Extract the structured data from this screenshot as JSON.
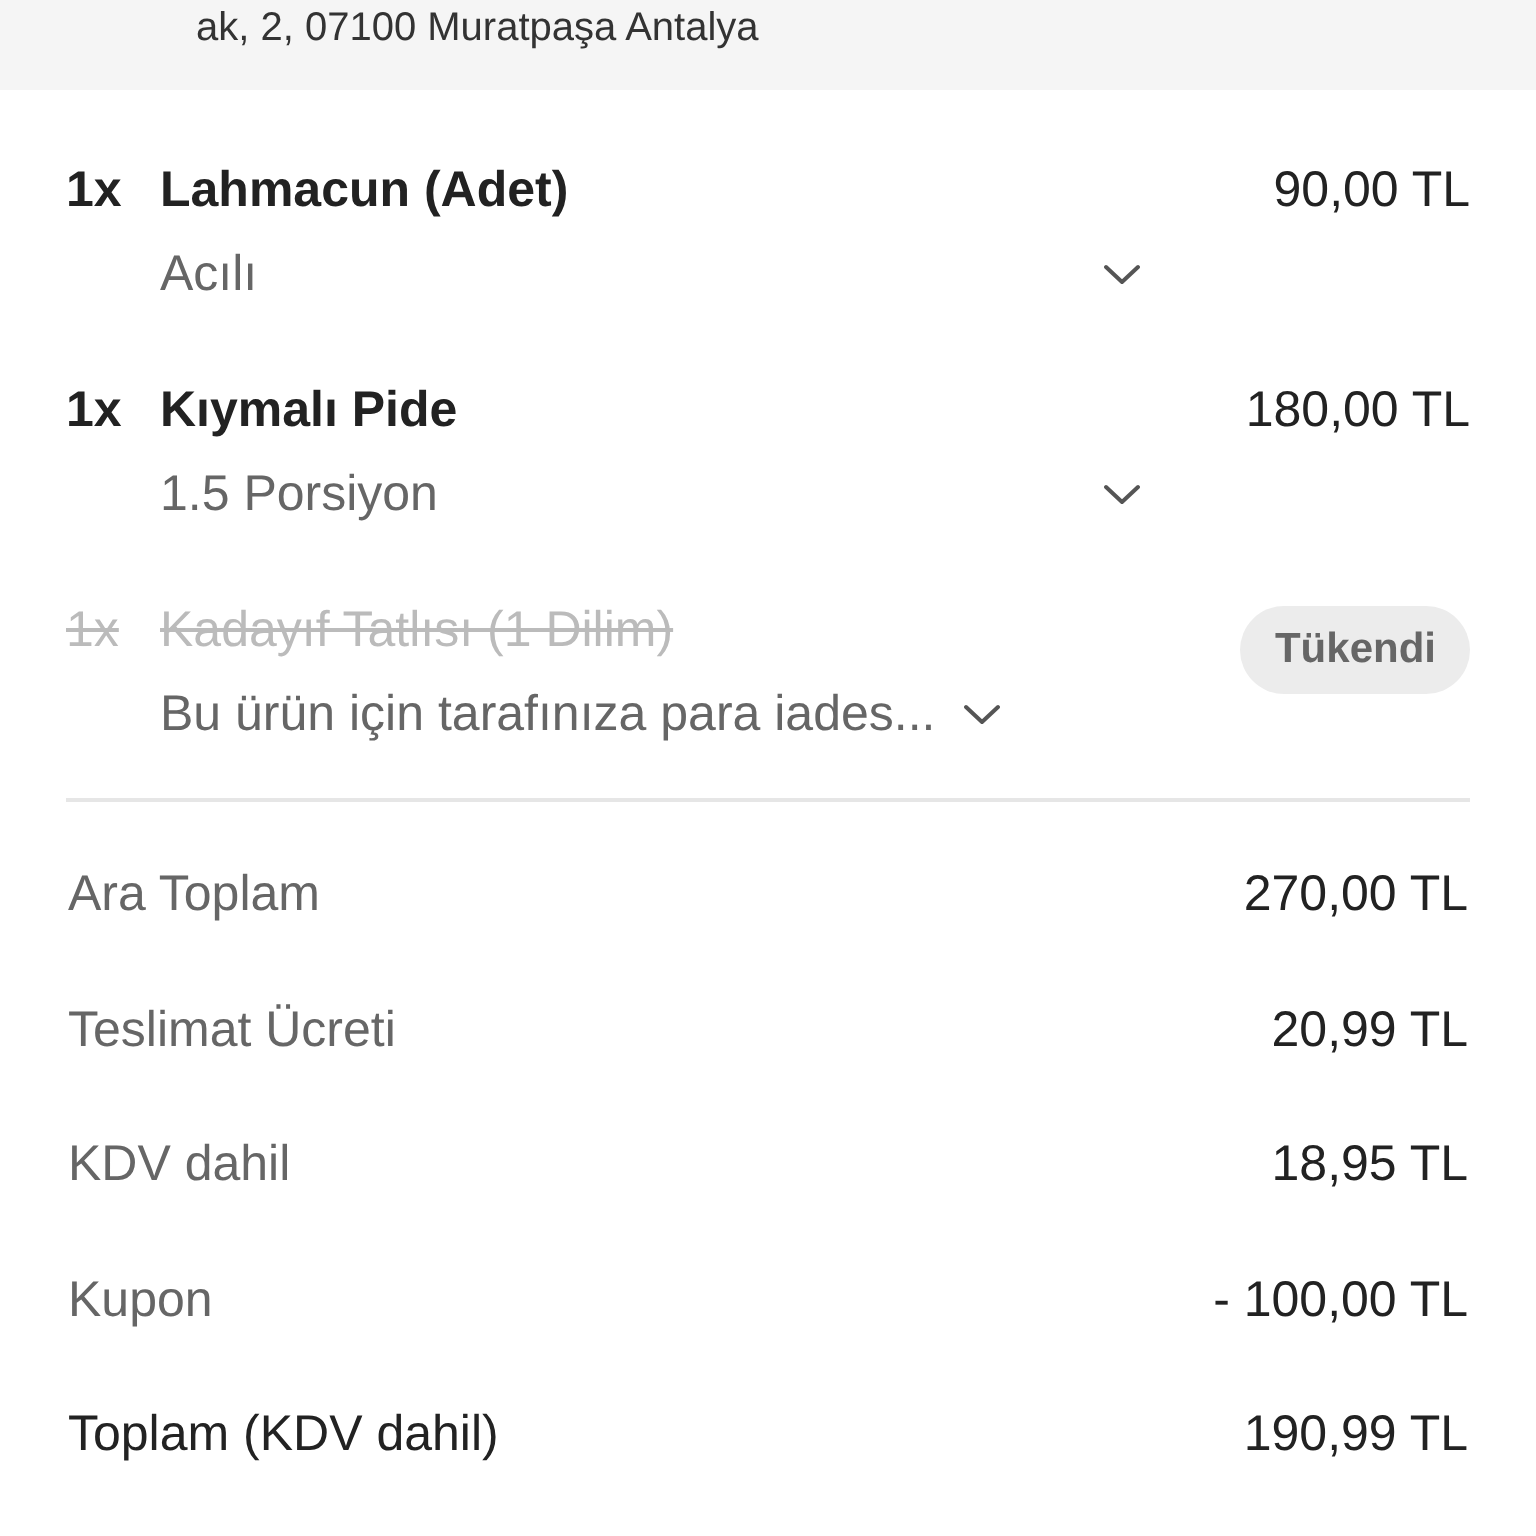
{
  "address": "ak, 2, 07100 Muratpaşa Antalya",
  "items": [
    {
      "quantity": "1x",
      "name": "Lahmacun (Adet)",
      "price": "90,00 TL",
      "note": "Acılı",
      "available": true
    },
    {
      "quantity": "1x",
      "name": "Kıymalı Pide",
      "price": "180,00 TL",
      "note": "1.5 Porsiyon",
      "available": true
    },
    {
      "quantity": "1x",
      "name": "Kadayıf Tatlısı (1 Dilim)",
      "badge": "Tükendi",
      "note": "Bu ürün için tarafınıza para iades...",
      "available": false
    }
  ],
  "summary": [
    {
      "label": "Ara Toplam",
      "value": "270,00 TL",
      "kind": "line"
    },
    {
      "label": "Teslimat Ücreti",
      "value": "20,99 TL",
      "kind": "line"
    },
    {
      "label": "KDV dahil",
      "value": "18,95 TL",
      "kind": "line"
    },
    {
      "label": "Kupon",
      "value": "- 100,00 TL",
      "kind": "line"
    },
    {
      "label": "Toplam (KDV dahil)",
      "value": "190,99 TL",
      "kind": "total"
    }
  ]
}
